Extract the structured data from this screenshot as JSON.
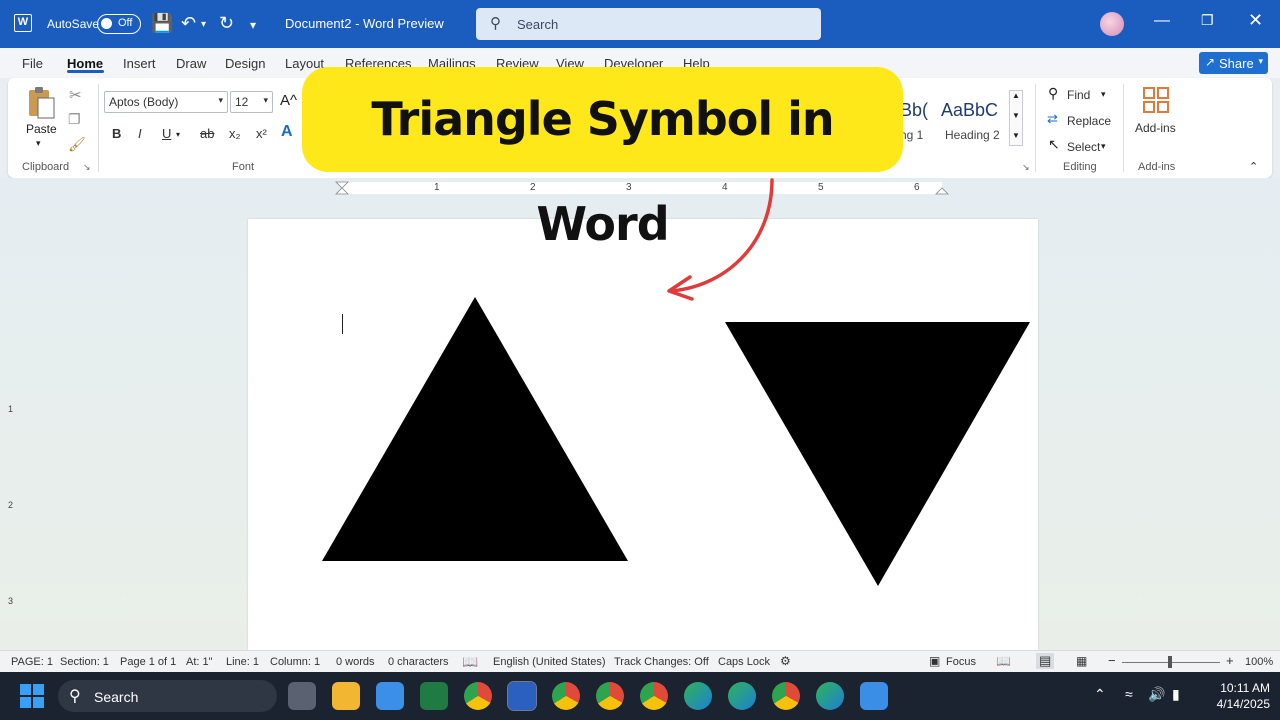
{
  "titlebar": {
    "autosave_label": "AutoSave",
    "autosave_state": "Off",
    "doc_title": "Document2  -  Word Preview",
    "search_placeholder": "Search"
  },
  "menu": {
    "tabs": [
      "File",
      "Home",
      "Insert",
      "Draw",
      "Design",
      "Layout",
      "References",
      "Mailings",
      "Review",
      "View",
      "Developer",
      "Help"
    ],
    "active_tab": "Home",
    "share_label": "Share"
  },
  "ribbon": {
    "clipboard": {
      "paste": "Paste",
      "group_label": "Clipboard"
    },
    "font": {
      "family": "Aptos (Body)",
      "size": "12",
      "group_label": "Font",
      "bold": "B",
      "italic": "I",
      "underline": "U",
      "strike": "ab",
      "subscript": "x₂",
      "superscript": "x²",
      "grow": "A^"
    },
    "styles": {
      "prev1": "Bb(",
      "name1": "ng 1",
      "prev2": "AaBbC",
      "name2": "Heading 2"
    },
    "editing": {
      "find": "Find",
      "replace": "Replace",
      "select": "Select",
      "group_label": "Editing"
    },
    "addins": {
      "label": "Add-ins",
      "group_label": "Add-ins"
    }
  },
  "callout": {
    "text": "Triangle Symbol in Word"
  },
  "ruler": {
    "labels": [
      "1",
      "2",
      "3",
      "4",
      "5",
      "6"
    ]
  },
  "vruler": {
    "labels": [
      "1",
      "2",
      "3"
    ]
  },
  "statusbar": {
    "page": "PAGE: 1",
    "section": "Section: 1",
    "page_of": "Page 1 of 1",
    "at": "At: 1\"",
    "line": "Line: 1",
    "column": "Column: 1",
    "words": "0 words",
    "characters": "0 characters",
    "language": "English (United States)",
    "track_changes": "Track Changes: Off",
    "caps_lock": "Caps Lock",
    "focus": "Focus",
    "zoom": "100%"
  },
  "taskbar": {
    "search_label": "Search",
    "time": "10:11 AM",
    "date": "4/14/2025"
  },
  "colors": {
    "titlebar": "#1a5dbf",
    "callout": "#ffe81a",
    "arrow": "#e03a3a",
    "taskbar": "#1c2330"
  }
}
